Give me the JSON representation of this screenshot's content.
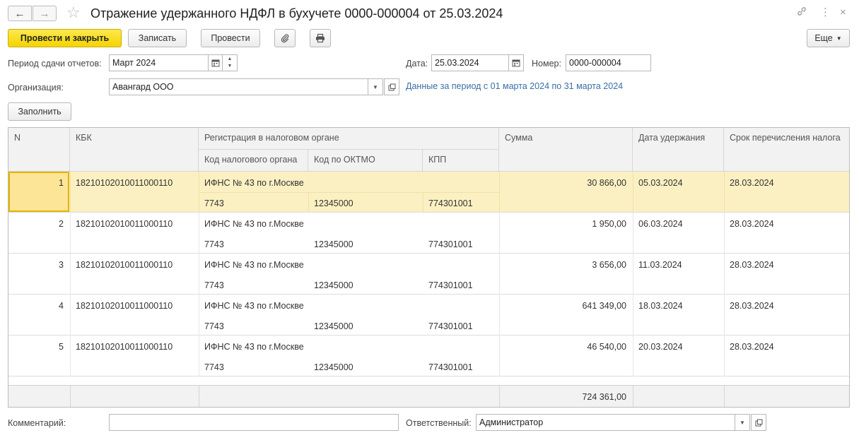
{
  "window": {
    "title": "Отражение удержанного НДФЛ в бухучете 0000-000004 от 25.03.2024",
    "back_icon": "←",
    "forward_icon": "→",
    "star_icon": "☆",
    "link_icon": "🔗",
    "more_icon": "⋮",
    "close_icon": "×"
  },
  "toolbar": {
    "post_close": "Провести и закрыть",
    "save": "Записать",
    "post": "Провести",
    "more": "Еще"
  },
  "form": {
    "period_label": "Период сдачи отчетов:",
    "period_value": "Март 2024",
    "date_label": "Дата:",
    "date_value": "25.03.2024",
    "number_label": "Номер:",
    "number_value": "0000-000004",
    "org_label": "Организация:",
    "org_value": "Авангард ООО",
    "period_info": "Данные за период с 01 марта 2024 по 31 марта 2024",
    "fill_button": "Заполнить",
    "comment_label": "Комментарий:",
    "comment_value": "",
    "responsible_label": "Ответственный:",
    "responsible_value": "Администратор"
  },
  "table": {
    "headers": {
      "n": "N",
      "kbk": "КБК",
      "reg": "Регистрация в налоговом органе",
      "tax_code": "Код налогового органа",
      "oktmo": "Код по ОКТМО",
      "kpp": "КПП",
      "sum": "Сумма",
      "date": "Дата удержания",
      "term": "Срок перечисления налога"
    },
    "rows": [
      {
        "n": "1",
        "kbk": "18210102010011000110",
        "org": "ИФНС № 43 по г.Москве",
        "code": "7743",
        "oktmo": "12345000",
        "kpp": "774301001",
        "sum": "30 866,00",
        "date": "05.03.2024",
        "term": "28.03.2024"
      },
      {
        "n": "2",
        "kbk": "18210102010011000110",
        "org": "ИФНС № 43 по г.Москве",
        "code": "7743",
        "oktmo": "12345000",
        "kpp": "774301001",
        "sum": "1 950,00",
        "date": "06.03.2024",
        "term": "28.03.2024"
      },
      {
        "n": "3",
        "kbk": "18210102010011000110",
        "org": "ИФНС № 43 по г.Москве",
        "code": "7743",
        "oktmo": "12345000",
        "kpp": "774301001",
        "sum": "3 656,00",
        "date": "11.03.2024",
        "term": "28.03.2024"
      },
      {
        "n": "4",
        "kbk": "18210102010011000110",
        "org": "ИФНС № 43 по г.Москве",
        "code": "7743",
        "oktmo": "12345000",
        "kpp": "774301001",
        "sum": "641 349,00",
        "date": "18.03.2024",
        "term": "28.03.2024"
      },
      {
        "n": "5",
        "kbk": "18210102010011000110",
        "org": "ИФНС № 43 по г.Москве",
        "code": "7743",
        "oktmo": "12345000",
        "kpp": "774301001",
        "sum": "46 540,00",
        "date": "20.03.2024",
        "term": "28.03.2024"
      }
    ],
    "total": "724 361,00"
  },
  "colors": {
    "primary_button": "#f5d400",
    "selected_row": "#fbf0c2",
    "link": "#3a6ea5"
  }
}
